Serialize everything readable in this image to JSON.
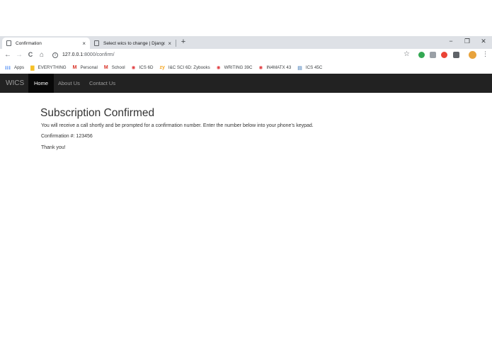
{
  "browser": {
    "tabs": [
      {
        "title": "Confirmation",
        "close": "×"
      },
      {
        "title": "Select wics to change | Django si",
        "close": "×"
      }
    ],
    "new_tab": "+",
    "window_controls": {
      "minimize": "−",
      "maximize": "❐",
      "close": "✕"
    },
    "nav": {
      "back": "←",
      "forward": "→",
      "reload": "C",
      "home": "⌂"
    },
    "address": {
      "host": "127.0.0.1",
      "path": ":8000/confirm/"
    },
    "bookmark_star": "☆",
    "menu": "⋮",
    "bookmarks": [
      {
        "label": "Apps",
        "icon": "apps-grid-icon",
        "glyph": "⁝⁝⁝",
        "color": "#4285f4"
      },
      {
        "label": "EVERYTHING",
        "icon": "folder-icon",
        "glyph": "▇",
        "color": "#f6c026"
      },
      {
        "label": "Personal",
        "icon": "gmail-icon",
        "glyph": "M",
        "color": "#d93025"
      },
      {
        "label": "School",
        "icon": "gmail-icon",
        "glyph": "M",
        "color": "#d93025"
      },
      {
        "label": "ICS 6D",
        "icon": "canvas-icon",
        "glyph": "✺",
        "color": "#e03a3e"
      },
      {
        "label": "I&C SCI 6D: Zybooks",
        "icon": "zybooks-icon",
        "glyph": "zy",
        "color": "#f5a623"
      },
      {
        "label": "WRITING 39C",
        "icon": "canvas-icon",
        "glyph": "✺",
        "color": "#e03a3e"
      },
      {
        "label": "IN4MATX 43",
        "icon": "canvas-icon",
        "glyph": "✺",
        "color": "#e03a3e"
      },
      {
        "label": "ICS 45C",
        "icon": "page-icon",
        "glyph": "▤",
        "color": "#2b6cb0"
      }
    ],
    "extension_colors": [
      "#34a853",
      "#9aa0a6",
      "#ea4335",
      "#5f6368",
      "#e8a33d"
    ]
  },
  "site": {
    "brand": "WICS",
    "nav": {
      "home": "Home",
      "about": "About Us",
      "contact": "Contact Us"
    }
  },
  "content": {
    "title": "Subscription Confirmed",
    "message": "You will receive a call shortly and be prompted for a confirmation number. Enter the number below into your phone's keypad.",
    "confirmation_label": "Confirmation #:",
    "confirmation_number": "123456",
    "thanks": "Thank you!"
  }
}
